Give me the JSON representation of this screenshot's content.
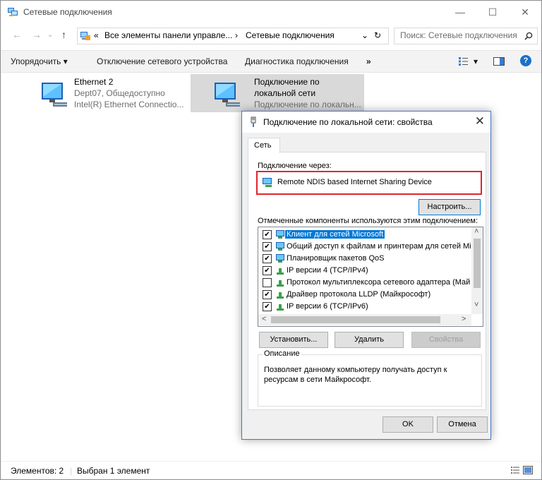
{
  "window": {
    "title": "Сетевые подключения",
    "min_glyph": "—",
    "max_glyph": "☐",
    "close_glyph": "✕"
  },
  "nav": {
    "back_glyph": "←",
    "forward_glyph": "→",
    "up_glyph": "↑",
    "chev_glyph": "«",
    "crumb1": "Все элементы панели управле...",
    "sep_glyph": "›",
    "crumb2": "Сетевые подключения",
    "dropdown_glyph": "⌄",
    "refresh_glyph": "↻",
    "search_placeholder": "Поиск: Сетевые подключения"
  },
  "commands": {
    "organize": "Упорядочить ▾",
    "disable": "Отключение сетевого устройства",
    "diagnose": "Диагностика подключения",
    "more": "»",
    "view_dropdown": "▾",
    "help": "?"
  },
  "connections": [
    {
      "name": "Ethernet 2",
      "status": "Dept07, Общедоступно",
      "device": "Intel(R) Ethernet Connectio..."
    },
    {
      "name1": "Подключение по",
      "name2": "локальной сети",
      "device": "Подключение по локальн..."
    }
  ],
  "statusbar": {
    "count": "Элементов: 2",
    "selected": "Выбран 1 элемент"
  },
  "dialog": {
    "title": "Подключение по локальной сети: свойства",
    "close_glyph": "✕",
    "tab": "Сеть",
    "connect_via_label": "Подключение через:",
    "adapter": "Remote NDIS based Internet Sharing Device",
    "configure_button": "Настроить...",
    "components_label": "Отмеченные компоненты используются этим подключением:",
    "components": [
      {
        "label": "Клиент для сетей Microsoft",
        "checked": "✔"
      },
      {
        "label": "Общий доступ к файлам и принтерам для сетей Mi",
        "checked": "✔"
      },
      {
        "label": "Планировщик пакетов QoS",
        "checked": "✔"
      },
      {
        "label": "IP версии 4 (TCP/IPv4)",
        "checked": "✔"
      },
      {
        "label": "Протокол мультиплексора сетевого адаптера (Май",
        "checked": ""
      },
      {
        "label": "Драйвер протокола LLDP (Майкрософт)",
        "checked": "✔"
      },
      {
        "label": "IP версии 6 (TCP/IPv6)",
        "checked": "✔"
      }
    ],
    "scroll_up": "˄",
    "scroll_down": "˅",
    "scroll_left": "<",
    "scroll_right": ">",
    "install_button": "Установить...",
    "remove_button": "Удалить",
    "properties_button": "Свойства",
    "description_label": "Описание",
    "description_text": "Позволяет данному компьютеру получать доступ к ресурсам в сети Майкрософт.",
    "ok_button": "OK",
    "cancel_button": "Отмена"
  }
}
